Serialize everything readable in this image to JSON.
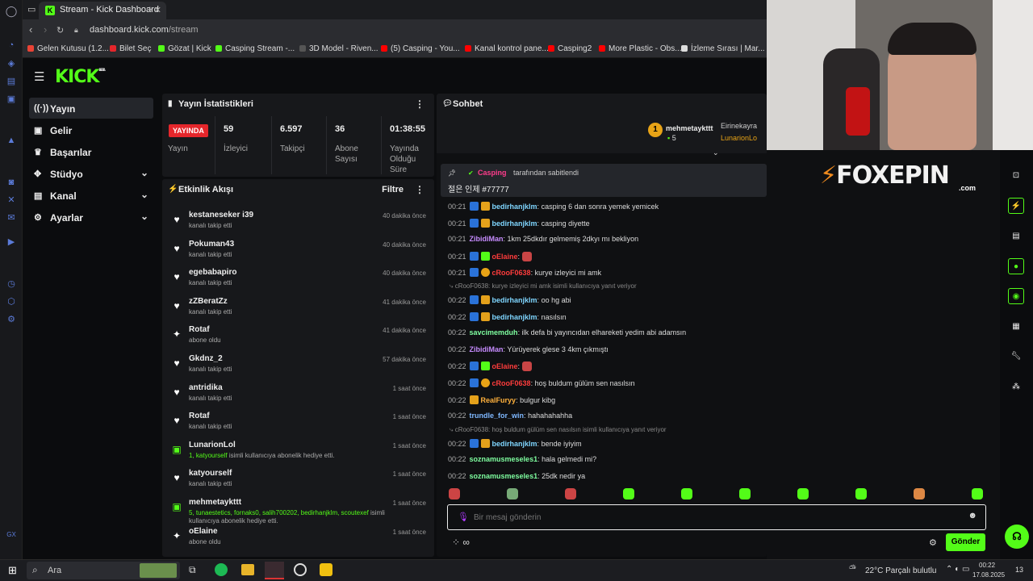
{
  "browser": {
    "tab_title": "Stream - Kick Dashboard",
    "new_tab": "+",
    "url_domain": "dashboard.kick.com",
    "url_path": "/stream",
    "bookmarks": [
      "Gelen Kutusu (1.2...",
      "Bilet Seç",
      "Gözat | Kick",
      "Casping Stream -...",
      "3D Model - Riven...",
      "(5) Casping - You...",
      "Kanal kontrol pane...",
      "Casping2",
      "More Plastic - Obs...",
      "İzleme Sırası | Mar..."
    ]
  },
  "brand": {
    "logo": "KICK",
    "beta": "BETA"
  },
  "sidebar": {
    "items": [
      {
        "label": "Yayın",
        "icon": "radio-icon"
      },
      {
        "label": "Gelir",
        "icon": "dollar-icon"
      },
      {
        "label": "Başarılar",
        "icon": "trophy-icon"
      },
      {
        "label": "Stüdyo",
        "icon": "studio-icon"
      },
      {
        "label": "Kanal",
        "icon": "channel-icon"
      },
      {
        "label": "Ayarlar",
        "icon": "gear-icon"
      }
    ]
  },
  "stats": {
    "title": "Yayın İstatistikleri",
    "live_badge": "YAYINDA",
    "live_label": "Yayın",
    "items": [
      {
        "value": "59",
        "label": "İzleyici"
      },
      {
        "value": "6.597",
        "label": "Takipçi"
      },
      {
        "value": "36",
        "label": "Abone Sayısı"
      },
      {
        "value": "01:38:55",
        "label": "Yayında Olduğu Süre"
      }
    ]
  },
  "activity": {
    "title": "Etkinlik Akışı",
    "filter": "Filtre",
    "items": [
      {
        "user": "kestaneseker i39",
        "desc": "kanalı takip etti",
        "time": "40 dakika önce",
        "type": "heart"
      },
      {
        "user": "Pokuman43",
        "desc": "kanalı takip etti",
        "time": "40 dakika önce",
        "type": "heart"
      },
      {
        "user": "egebabapiro",
        "desc": "kanalı takip etti",
        "time": "40 dakika önce",
        "type": "heart"
      },
      {
        "user": "zZBeratZz",
        "desc": "kanalı takip etti",
        "time": "41 dakika önce",
        "type": "heart"
      },
      {
        "user": "Rotaf",
        "desc": "abone oldu",
        "time": "41 dakika önce",
        "type": "star"
      },
      {
        "user": "Gkdnz_2",
        "desc": "kanalı takip etti",
        "time": "57 dakika önce",
        "type": "heart"
      },
      {
        "user": "antridika",
        "desc": "kanalı takip etti",
        "time": "1 saat önce",
        "type": "heart"
      },
      {
        "user": "Rotaf",
        "desc": "kanalı takip etti",
        "time": "1 saat önce",
        "type": "heart"
      },
      {
        "user": "LunarionLol",
        "desc_green": "1, katyourself",
        "desc": "isimli kullanıcıya abonelik hediye etti.",
        "time": "1 saat önce",
        "type": "gift"
      },
      {
        "user": "katyourself",
        "desc": "kanalı takip etti",
        "time": "1 saat önce",
        "type": "heart"
      },
      {
        "user": "mehmetaykttt",
        "desc_green": "5, tunaestetics, fornaks0, salih700202, bedirhanjklm, scoutexef",
        "desc": "isimli kullanıcıya abonelik hediye etti.",
        "time": "1 saat önce",
        "type": "gift"
      },
      {
        "user": "oElaine",
        "desc": "abone oldu",
        "time": "1 saat önce",
        "type": "star"
      }
    ]
  },
  "chat": {
    "title": "Sohbet",
    "top_gifter": {
      "rank": "1",
      "name": "mehmetaykttt",
      "count": "5"
    },
    "second": {
      "name1": "Eirinekayra",
      "name2": "LunarionLo"
    },
    "pinned": {
      "by": "Casping",
      "by_suffix": "tarafından sabitlendi",
      "text": "절은 인제 #77777"
    },
    "overlay_logo": "FOXEPIN",
    "overlay_sub": ".com",
    "messages": [
      {
        "time": "00:21",
        "user": "bedirhanjklm",
        "text": "casping 6 dan sonra yemek yemicek",
        "color": "#7fd6ff",
        "badges": [
          "bb",
          "by"
        ]
      },
      {
        "time": "00:21",
        "user": "bedirhanjklm",
        "text": "casping diyette",
        "color": "#7fd6ff",
        "badges": [
          "bb",
          "by"
        ]
      },
      {
        "time": "00:21",
        "user": "ZibidiMan",
        "text": "1km 25dkdır gelmemiş 2dkyı mı bekliyon",
        "color": "#c78cff",
        "badges": []
      },
      {
        "time": "00:21",
        "user": "oElaine",
        "text": "",
        "color": "#ff3c3c",
        "badges": [
          "bb",
          "bg"
        ]
      },
      {
        "time": "00:21",
        "user": "cRooF0638",
        "text": "kurye izleyici mi amk",
        "color": "#ff3c3c",
        "badges": [
          "bb",
          "bo"
        ]
      },
      {
        "reply": "cRooF0638: kurye izleyici mi amk isimli kullanıcıya yanıt veriyor"
      },
      {
        "time": "00:22",
        "user": "bedirhanjklm",
        "text": "oo hg abi",
        "color": "#7fd6ff",
        "badges": [
          "bb",
          "by"
        ]
      },
      {
        "time": "00:22",
        "user": "bedirhanjklm",
        "text": "nasılsın",
        "color": "#7fd6ff",
        "badges": [
          "bb",
          "by"
        ]
      },
      {
        "time": "00:22",
        "user": "savcimemduh",
        "text": "ilk defa bi yayıncıdan elhareketi yedim abi adamsın",
        "color": "#7fffa0",
        "badges": []
      },
      {
        "time": "00:22",
        "user": "ZibidiMan",
        "text": "Yürüyerek glese 3 4km çıkmıştı",
        "color": "#c78cff",
        "badges": []
      },
      {
        "time": "00:22",
        "user": "oElaine",
        "text": "",
        "color": "#ff3c3c",
        "badges": [
          "bb",
          "bg"
        ]
      },
      {
        "time": "00:22",
        "user": "cRooF0638",
        "text": "hoş buldum gülüm sen nasılsın",
        "color": "#ff3c3c",
        "badges": [
          "bb",
          "bo"
        ]
      },
      {
        "time": "00:22",
        "user": "RealFuryy",
        "text": "bulgur kibg",
        "color": "#ffb13c",
        "badges": [
          "by"
        ]
      },
      {
        "time": "00:22",
        "user": "trundle_for_win",
        "text": "hahahahahha",
        "color": "#7fb8ff",
        "badges": []
      },
      {
        "reply": "cRooF0638: hoş buldum gülüm sen nasılsın isimli kullanıcıya yanıt veriyor"
      },
      {
        "time": "00:22",
        "user": "bedirhanjklm",
        "text": "bende iyiyim",
        "color": "#7fd6ff",
        "badges": [
          "bb",
          "by"
        ]
      },
      {
        "time": "00:22",
        "user": "soznamusmeseles1",
        "text": "hala gelmedi mi?",
        "color": "#7fffa0",
        "badges": []
      },
      {
        "time": "00:22",
        "user": "soznamusmeseles1",
        "text": "25dk nedir ya",
        "color": "#7fffa0",
        "badges": []
      }
    ],
    "input_placeholder": "Bir mesaj gönderin",
    "send": "Gönder",
    "infinity": "∞"
  },
  "taskbar": {
    "search": "Ara",
    "weather": "22°C  Parçalı bulutlu",
    "time": "00:22",
    "date": "17.08.2025",
    "notif": "13"
  },
  "colors": {
    "accent": "#53fc18",
    "live": "#e5262b"
  }
}
